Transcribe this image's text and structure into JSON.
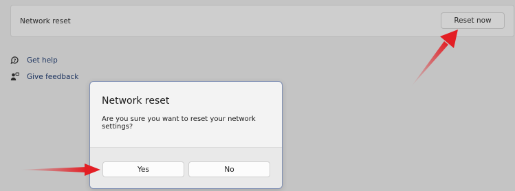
{
  "settings": {
    "network_reset_label": "Network reset",
    "reset_now_button": "Reset now"
  },
  "links": [
    {
      "label": "Get help",
      "icon": "get-help-icon"
    },
    {
      "label": "Give feedback",
      "icon": "give-feedback-icon"
    }
  ],
  "dialog": {
    "title": "Network reset",
    "message": "Are you sure you want to reset your network settings?",
    "yes_label": "Yes",
    "no_label": "No"
  },
  "annotations": {
    "arrow_color": "#e31e24"
  }
}
